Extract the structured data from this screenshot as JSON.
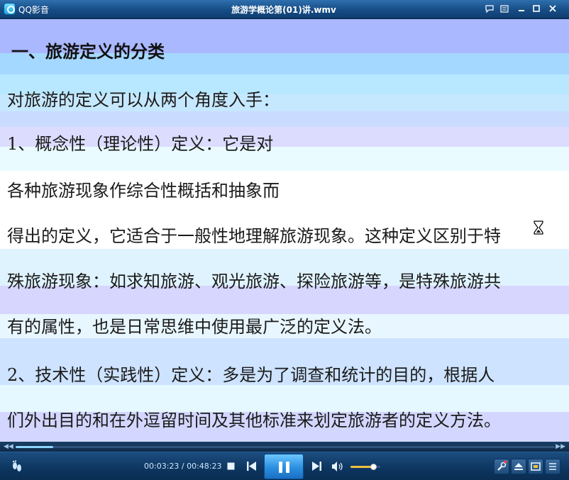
{
  "titlebar": {
    "app_name": "QQ影音",
    "window_title": "旅游学概论第(01)讲.wmv"
  },
  "video": {
    "lines": [
      "一、旅游定义的分类",
      "对旅游的定义可以从两个角度入手：",
      "1、概念性（理论性）定义：它是对",
      "各种旅游现象作综合性概括和抽象而",
      "得出的定义，它适合于一般性地理解旅游现象。这种定义区别于特",
      "殊旅游现象：如求知旅游、观光旅游、探险旅游等，是特殊旅游共",
      "有的属性，也是日常思维中使用最广泛的定义法。",
      " 2、技术性（实践性）定义：多是为了调查和统计的目的，根据人",
      "们外出目的和在外逗留时间及其他标准来划定旅游者的定义方法。"
    ]
  },
  "player": {
    "current_time": "00:03:23",
    "total_time": "00:48:23",
    "time_display": "00:03:23 / 00:48:23",
    "progress_fraction": 0.07,
    "volume_fraction": 0.75,
    "seek_back_symbol": "◀◀",
    "seek_forward_symbol": "▶▶"
  },
  "icons": {
    "footprint": "footprint-icon",
    "stop": "stop-icon",
    "prev": "previous-icon",
    "pause": "pause-icon",
    "next": "next-icon",
    "volume": "volume-icon",
    "tools": "tools-icon",
    "eject": "eject-icon",
    "screen": "screen-icon",
    "playlist": "playlist-icon"
  },
  "colors": {
    "accent": "#2b8fe0",
    "volume_fill": "#f0c040"
  }
}
